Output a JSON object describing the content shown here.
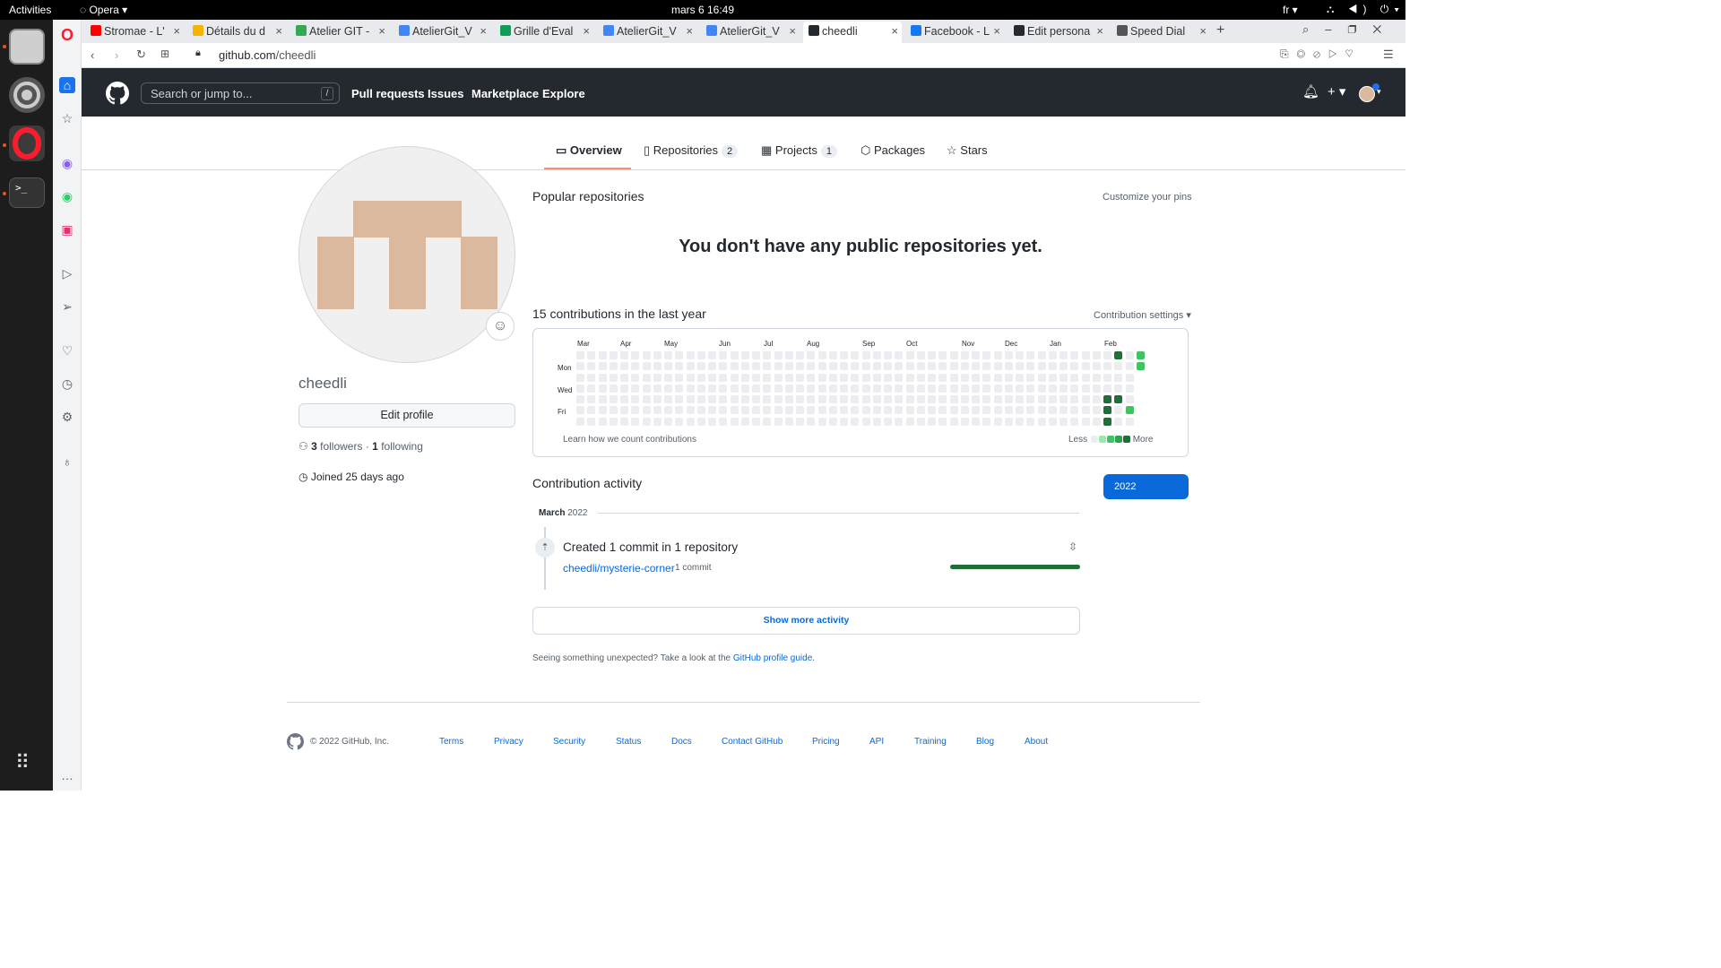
{
  "topbar": {
    "activities": "Activities",
    "app": "Opera",
    "clock": "mars 6  16:49",
    "lang": "fr"
  },
  "tabs": [
    {
      "label": "Stromae - L'",
      "color": "#ff0000",
      "active": false
    },
    {
      "label": "Détails du d",
      "color": "#f4b400",
      "active": false
    },
    {
      "label": "Atelier GIT -",
      "color": "#34a853",
      "active": false
    },
    {
      "label": "AtelierGit_V",
      "color": "#4285f4",
      "active": false
    },
    {
      "label": "Grille d'Eval",
      "color": "#0f9d58",
      "active": false
    },
    {
      "label": "AtelierGit_V",
      "color": "#4285f4",
      "active": false
    },
    {
      "label": "AtelierGit_V",
      "color": "#4285f4",
      "active": false
    },
    {
      "label": "cheedli",
      "color": "#24292f",
      "active": true
    },
    {
      "label": "Facebook - L",
      "color": "#1877f2",
      "active": false
    },
    {
      "label": "Edit persona",
      "color": "#24292f",
      "active": false
    },
    {
      "label": "Speed Dial",
      "color": "#555555",
      "active": false
    }
  ],
  "address": {
    "host": "github.com",
    "path": "/cheedli"
  },
  "gh_header": {
    "search_placeholder": "Search or jump to...",
    "slash": "/",
    "nav": [
      "Pull requests",
      "Issues",
      "Marketplace",
      "Explore"
    ]
  },
  "profile_nav": {
    "tabs": [
      {
        "label": "Overview",
        "count": "",
        "icon": "book-icon"
      },
      {
        "label": "Repositories",
        "count": "2",
        "icon": "repo-icon"
      },
      {
        "label": "Projects",
        "count": "1",
        "icon": "project-icon"
      },
      {
        "label": "Packages",
        "count": "",
        "icon": "package-icon"
      },
      {
        "label": "Stars",
        "count": "",
        "icon": "star-icon"
      }
    ]
  },
  "profile": {
    "username": "cheedli",
    "edit_label": "Edit profile",
    "followers_count": "3",
    "followers_label": "followers",
    "following_count": "1",
    "following_label": "following",
    "joined": "Joined 25 days ago"
  },
  "main": {
    "popular_title": "Popular repositories",
    "customize": "Customize your pins",
    "no_repos": "You don't have any public repositories yet.",
    "contrib_title": "15 contributions in the last year",
    "contrib_settings": "Contribution settings",
    "learn": "Learn how we count contributions",
    "legend_less": "Less",
    "legend_more": "More",
    "months": [
      "Mar",
      "Apr",
      "May",
      "Jun",
      "Jul",
      "Aug",
      "Sep",
      "Oct",
      "Nov",
      "Dec",
      "Jan",
      "Feb"
    ],
    "days": [
      "Mon",
      "Wed",
      "Fri"
    ],
    "activity_title": "Contribution activity",
    "year": "2022",
    "month_label": "March",
    "month_year": "2022",
    "commit_heading": "Created 1 commit in 1 repository",
    "repo": "cheedli/mysterie-corner",
    "repo_commits": "1 commit",
    "repo_share": 1.0,
    "show_more": "Show more activity",
    "unexpected": "Seeing something unexpected? Take a look at the",
    "profile_guide": "GitHub profile guide."
  },
  "contrib_colors": [
    "#ebedf0",
    "#9be9a8",
    "#40c463",
    "#30a14e",
    "#216e39"
  ],
  "contrib_cells": [
    {
      "week": 49,
      "day": 0,
      "level": 4
    },
    {
      "week": 50,
      "day": 0,
      "level": 0
    },
    {
      "week": 51,
      "day": 0,
      "level": 2
    },
    {
      "week": 51,
      "day": 1,
      "level": 2
    },
    {
      "week": 48,
      "day": 4,
      "level": 4
    },
    {
      "week": 49,
      "day": 4,
      "level": 4
    },
    {
      "week": 48,
      "day": 5,
      "level": 4
    },
    {
      "week": 50,
      "day": 5,
      "level": 2
    },
    {
      "week": 48,
      "day": 6,
      "level": 4
    }
  ],
  "footer": {
    "copyright": "© 2022 GitHub, Inc.",
    "links": [
      "Terms",
      "Privacy",
      "Security",
      "Status",
      "Docs",
      "Contact GitHub",
      "Pricing",
      "API",
      "Training",
      "Blog",
      "About"
    ]
  }
}
